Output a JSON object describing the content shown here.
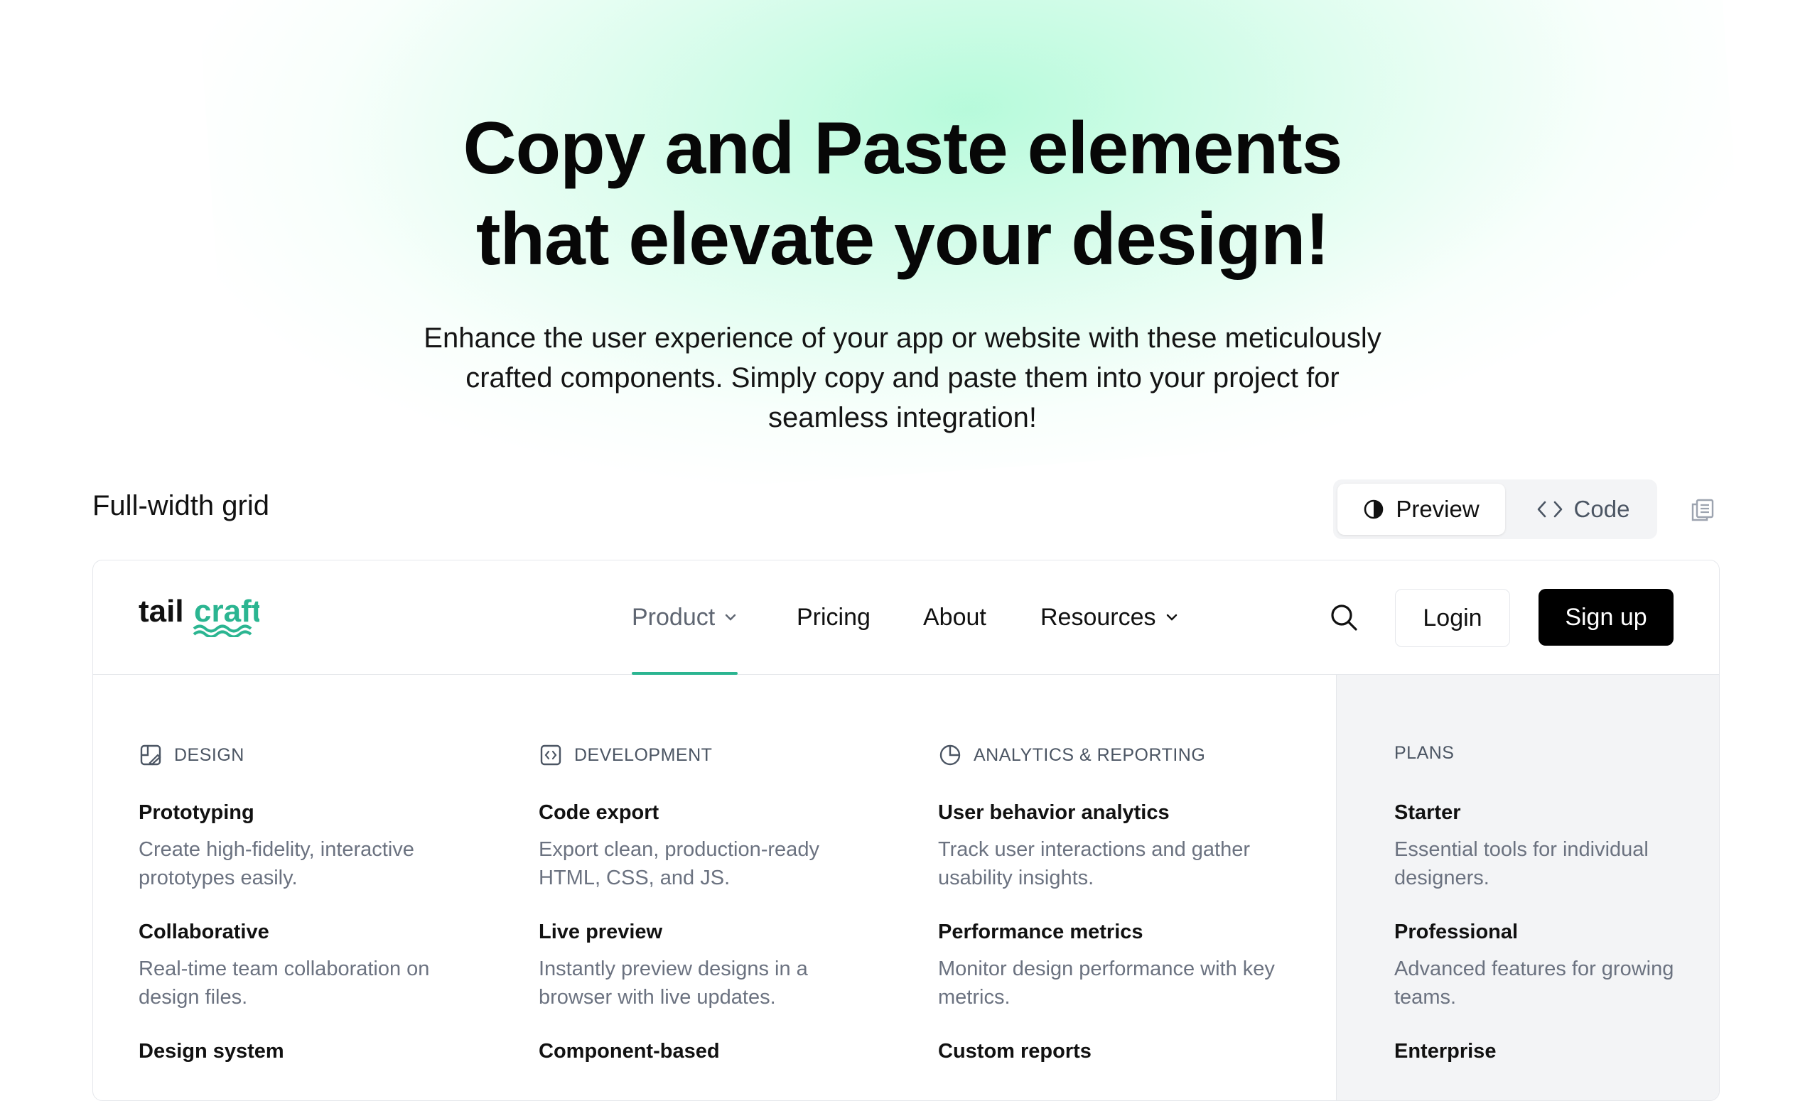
{
  "hero": {
    "title_line1": "Copy and Paste elements",
    "title_line2": "that elevate your design!",
    "subtitle": "Enhance the user experience of your app or website with these meticulously crafted components. Simply copy and paste them into your project for seamless integration!"
  },
  "section": {
    "title": "Full-width grid",
    "toggle": {
      "preview_label": "Preview",
      "code_label": "Code",
      "active": "Preview"
    },
    "copy_icon": "copy-icon"
  },
  "navbar": {
    "logo_text_plain": "tail",
    "logo_text_accent": "craft",
    "items": [
      {
        "label": "Product",
        "has_dropdown": true,
        "active": true
      },
      {
        "label": "Pricing",
        "has_dropdown": false
      },
      {
        "label": "About",
        "has_dropdown": false
      },
      {
        "label": "Resources",
        "has_dropdown": true
      }
    ],
    "search_icon": "search-icon",
    "login_label": "Login",
    "signup_label": "Sign up"
  },
  "mega_menu": {
    "columns": [
      {
        "heading": "DESIGN",
        "icon": "design-icon",
        "items": [
          {
            "title": "Prototyping",
            "desc": "Create high-fidelity, interactive prototypes easily."
          },
          {
            "title": "Collaborative",
            "desc": "Real-time team collaboration on design files."
          },
          {
            "title": "Design system",
            "desc": ""
          }
        ]
      },
      {
        "heading": "DEVELOPMENT",
        "icon": "code-icon",
        "items": [
          {
            "title": "Code export",
            "desc": "Export clean, production-ready HTML, CSS, and JS."
          },
          {
            "title": "Live preview",
            "desc": "Instantly preview designs in a browser with live updates."
          },
          {
            "title": "Component-based",
            "desc": ""
          }
        ]
      },
      {
        "heading": "ANALYTICS & REPORTING",
        "icon": "pie-chart-icon",
        "items": [
          {
            "title": "User behavior analytics",
            "desc": "Track user interactions and gather usability insights."
          },
          {
            "title": "Performance metrics",
            "desc": "Monitor design performance with key metrics."
          },
          {
            "title": "Custom reports",
            "desc": ""
          }
        ]
      },
      {
        "heading": "PLANS",
        "icon": "",
        "items": [
          {
            "title": "Starter",
            "desc": "Essential tools for individual designers."
          },
          {
            "title": "Professional",
            "desc": "Advanced features for growing teams."
          },
          {
            "title": "Enterprise",
            "desc": ""
          }
        ]
      }
    ]
  },
  "colors": {
    "accent": "#2bb591",
    "glow": "#c8fbe3",
    "plans_bg": "#f3f4f6",
    "signup_bg": "#000000"
  }
}
